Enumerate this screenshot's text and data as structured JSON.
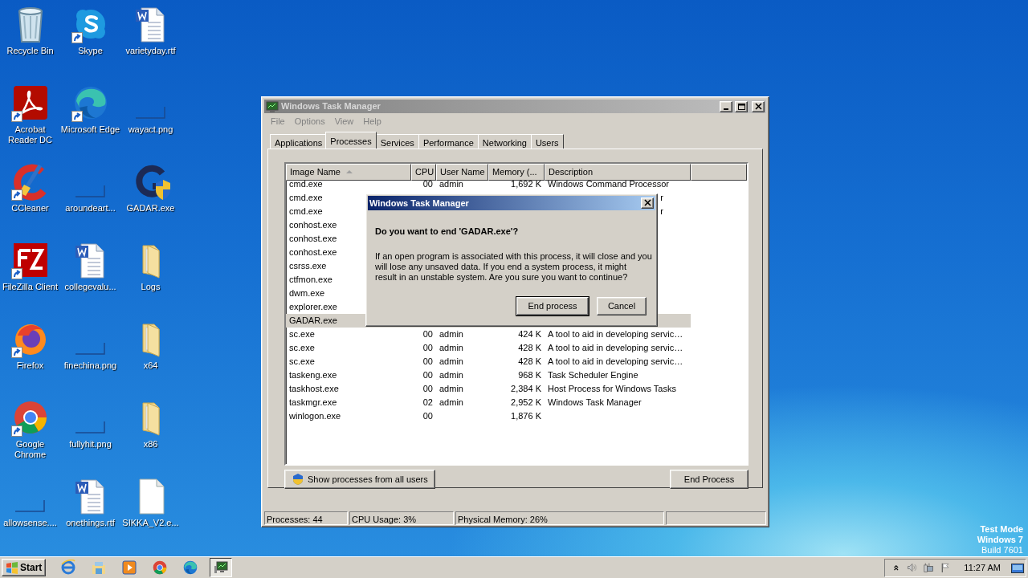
{
  "desktop_icons": [
    {
      "label": "Recycle Bin",
      "kind": "trash",
      "shortcut": false
    },
    {
      "label": "Skype",
      "kind": "chat",
      "shortcut": true
    },
    {
      "label": "varietyday.rtf",
      "kind": "word",
      "shortcut": false
    },
    {
      "label": "Acrobat Reader DC",
      "kind": "pdf",
      "shortcut": true
    },
    {
      "label": "Microsoft Edge",
      "kind": "edge",
      "shortcut": true
    },
    {
      "label": "wayact.png",
      "kind": "thumb",
      "shortcut": false
    },
    {
      "label": "CCleaner",
      "kind": "brush",
      "shortcut": true
    },
    {
      "label": "aroundeart...",
      "kind": "thumb",
      "shortcut": false
    },
    {
      "label": "GADAR.exe",
      "kind": "shield",
      "shortcut": false
    },
    {
      "label": "FileZilla Client",
      "kind": "fz",
      "shortcut": true
    },
    {
      "label": "collegevalu...",
      "kind": "word",
      "shortcut": false
    },
    {
      "label": "Logs",
      "kind": "folder",
      "shortcut": false
    },
    {
      "label": "Firefox",
      "kind": "firefox",
      "shortcut": true
    },
    {
      "label": "finechina.png",
      "kind": "thumb",
      "shortcut": false
    },
    {
      "label": "x64",
      "kind": "folder",
      "shortcut": false
    },
    {
      "label": "Google Chrome",
      "kind": "chrome",
      "shortcut": true
    },
    {
      "label": "fullyhit.png",
      "kind": "thumb",
      "shortcut": false
    },
    {
      "label": "x86",
      "kind": "folder",
      "shortcut": false
    },
    {
      "label": "allowsense....",
      "kind": "thumb",
      "shortcut": false
    },
    {
      "label": "onethings.rtf",
      "kind": "word",
      "shortcut": false
    },
    {
      "label": "SIKKA_V2.e...",
      "kind": "file",
      "shortcut": false
    }
  ],
  "task_manager": {
    "title": "Windows Task Manager",
    "menu": [
      {
        "label": "File"
      },
      {
        "label": "Options"
      },
      {
        "label": "View"
      },
      {
        "label": "Help"
      }
    ],
    "tabs": [
      {
        "label": "Applications",
        "selected": false
      },
      {
        "label": "Processes",
        "selected": true
      },
      {
        "label": "Services",
        "selected": false
      },
      {
        "label": "Performance",
        "selected": false
      },
      {
        "label": "Networking",
        "selected": false
      },
      {
        "label": "Users",
        "selected": false
      }
    ],
    "columns": [
      {
        "label": "Image Name",
        "sorted": true
      },
      {
        "label": "CPU",
        "sorted": false
      },
      {
        "label": "User Name",
        "sorted": false
      },
      {
        "label": "Memory (...",
        "sorted": false
      },
      {
        "label": "Description",
        "sorted": false
      }
    ],
    "rows": [
      {
        "image_name": "cmd.exe",
        "cpu": "00",
        "user_name": "admin",
        "memory": "1,692 K",
        "description": "Windows Command Processor",
        "selected": false
      },
      {
        "image_name": "cmd.exe",
        "description_tail": "r",
        "selected": false
      },
      {
        "image_name": "cmd.exe",
        "description_tail": "r",
        "selected": false
      },
      {
        "image_name": "conhost.exe",
        "selected": false
      },
      {
        "image_name": "conhost.exe",
        "selected": false
      },
      {
        "image_name": "conhost.exe",
        "selected": false
      },
      {
        "image_name": "csrss.exe",
        "selected": false
      },
      {
        "image_name": "ctfmon.exe",
        "selected": false
      },
      {
        "image_name": "dwm.exe",
        "selected": false
      },
      {
        "image_name": "explorer.exe",
        "selected": false
      },
      {
        "image_name": "GADAR.exe",
        "selected": true
      },
      {
        "image_name": "sc.exe",
        "cpu": "00",
        "user_name": "admin",
        "memory": "424 K",
        "description": "A tool to aid in developing servic…",
        "selected": false
      },
      {
        "image_name": "sc.exe",
        "cpu": "00",
        "user_name": "admin",
        "memory": "428 K",
        "description": "A tool to aid in developing servic…",
        "selected": false
      },
      {
        "image_name": "sc.exe",
        "cpu": "00",
        "user_name": "admin",
        "memory": "428 K",
        "description": "A tool to aid in developing servic…",
        "selected": false
      },
      {
        "image_name": "taskeng.exe",
        "cpu": "00",
        "user_name": "admin",
        "memory": "968 K",
        "description": "Task Scheduler Engine",
        "selected": false
      },
      {
        "image_name": "taskhost.exe",
        "cpu": "00",
        "user_name": "admin",
        "memory": "2,384 K",
        "description": "Host Process for Windows Tasks",
        "selected": false
      },
      {
        "image_name": "taskmgr.exe",
        "cpu": "02",
        "user_name": "admin",
        "memory": "2,952 K",
        "description": "Windows Task Manager",
        "selected": false
      },
      {
        "image_name": "winlogon.exe",
        "cpu": "00",
        "memory": "1,876 K",
        "selected": false
      }
    ],
    "show_all_button": "Show processes from all users",
    "end_process_button": "End Process",
    "status_bar": [
      "Processes: 44",
      "CPU Usage: 3%",
      "Physical Memory: 26%"
    ]
  },
  "dialog": {
    "title": "Windows Task Manager",
    "heading": "Do you want to end 'GADAR.exe'?",
    "message_lines": [
      "If an open program is associated with this process, it will close and you",
      "will lose any unsaved data. If you end a system process, it might",
      "result in an unstable system. Are you sure you want to continue?"
    ],
    "buttons": [
      {
        "label": "End process",
        "default": true
      },
      {
        "label": "Cancel",
        "default": false
      }
    ]
  },
  "os_notice": [
    "Test Mode",
    "Windows 7",
    "Build 7601"
  ],
  "taskbar": {
    "start": "Start",
    "apps": [
      {
        "kind": "ie",
        "active": false
      },
      {
        "kind": "explorer",
        "active": false
      },
      {
        "kind": "media",
        "active": false
      },
      {
        "kind": "chrome",
        "active": false
      },
      {
        "kind": "edge",
        "active": false
      },
      {
        "kind": "taskmgr",
        "active": true
      }
    ],
    "clock": "11:27 AM"
  }
}
